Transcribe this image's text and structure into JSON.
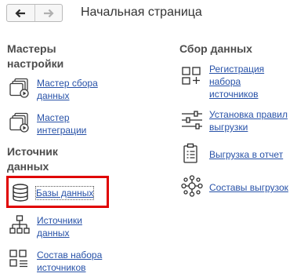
{
  "toolbar": {
    "back_icon": "arrow-left-icon",
    "forward_icon": "arrow-right-icon"
  },
  "page": {
    "title": "Начальная страница"
  },
  "sections": {
    "masters": {
      "title": "Мастеры\nнастройки",
      "items": [
        {
          "label": "Мастер сбора\nданных",
          "icon": "wizard-icon"
        },
        {
          "label": "Мастер\nинтеграции",
          "icon": "wizard-icon"
        }
      ]
    },
    "source": {
      "title": "Источник\nданных",
      "items": [
        {
          "label": "Базы данных",
          "icon": "database-icon"
        },
        {
          "label": "Источники\nданных",
          "icon": "hierarchy-icon"
        },
        {
          "label": "Состав набора\nисточников",
          "icon": "grid-list-icon"
        }
      ]
    },
    "collect": {
      "title": "Сбор данных",
      "items": [
        {
          "label": "Регистрация\nнабора\nисточников",
          "icon": "grid-add-icon"
        },
        {
          "label": "Установка правил\nвыгрузки",
          "icon": "sliders-icon"
        },
        {
          "label": "Выгрузка в отчет",
          "icon": "clipboard-list-icon"
        },
        {
          "label": "Составы выгрузок",
          "icon": "network-icon"
        }
      ]
    }
  },
  "colors": {
    "link": "#2852a8",
    "highlight": "#e00000",
    "heading": "#4d4d4d"
  }
}
